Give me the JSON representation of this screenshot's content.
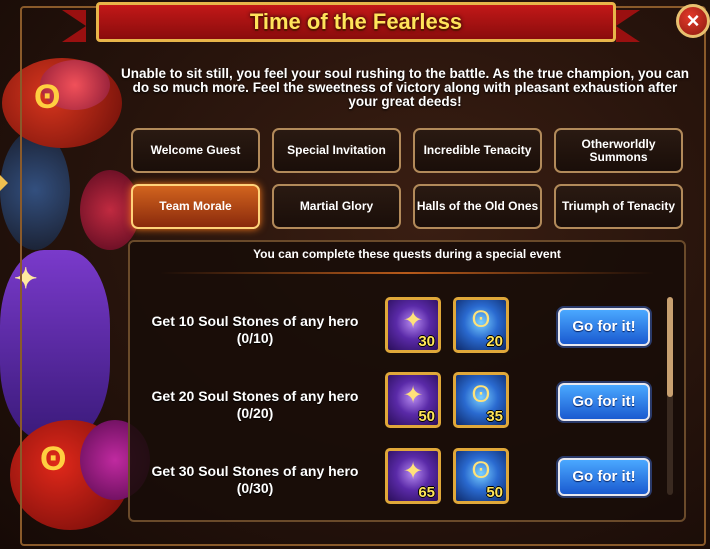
{
  "window": {
    "title": "Time of the Fearless",
    "close_label": "×"
  },
  "intro": "Unable to sit still, you feel your soul rushing to the battle. As the true champion, you can do so much more. Feel the sweetness of victory along with pleasant exhaustion after your great deeds!",
  "tabs": [
    {
      "label": "Welcome Guest",
      "active": false
    },
    {
      "label": "Special Invitation",
      "active": false
    },
    {
      "label": "Incredible Tenacity",
      "active": false
    },
    {
      "label": "Otherworldly Summons",
      "active": false
    },
    {
      "label": "Team Morale",
      "active": true
    },
    {
      "label": "Martial Glory",
      "active": false
    },
    {
      "label": "Halls of the Old Ones",
      "active": false
    },
    {
      "label": "Triumph of Tenacity",
      "active": false
    }
  ],
  "panel": {
    "heading": "You can complete these quests during a special event"
  },
  "quests": [
    {
      "title": "Get 10 Soul Stones of any hero",
      "progress": "(0/10)",
      "rewards": [
        {
          "icon": "purple-soul-coin-icon",
          "qty": "30"
        },
        {
          "icon": "blue-soul-coin-icon",
          "qty": "20"
        }
      ],
      "button": "Go for it!"
    },
    {
      "title": "Get 20 Soul Stones of any hero",
      "progress": "(0/20)",
      "rewards": [
        {
          "icon": "purple-soul-coin-icon",
          "qty": "50"
        },
        {
          "icon": "blue-soul-coin-icon",
          "qty": "35"
        }
      ],
      "button": "Go for it!"
    },
    {
      "title": "Get 30 Soul Stones of any hero",
      "progress": "(0/30)",
      "rewards": [
        {
          "icon": "purple-soul-coin-icon",
          "qty": "65"
        },
        {
          "icon": "blue-soul-coin-icon",
          "qty": "50"
        }
      ],
      "button": "Go for it!"
    }
  ],
  "colors": {
    "title": "#ffe45a",
    "banner": "#c21818",
    "active_tab": "#d2641e",
    "button": "#2a7ae8",
    "reward_qty": "#ffe45a"
  }
}
